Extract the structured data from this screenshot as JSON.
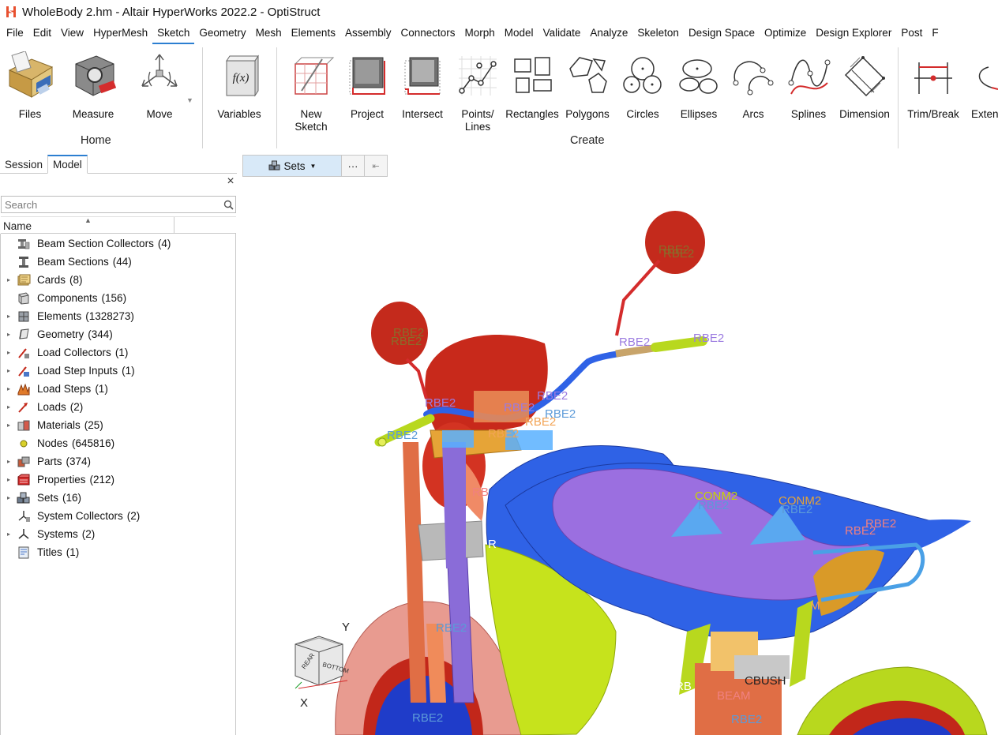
{
  "window": {
    "title": "WholeBody 2.hm - Altair HyperWorks 2022.2 - OptiStruct"
  },
  "menu": [
    "File",
    "Edit",
    "View",
    "HyperMesh",
    "Sketch",
    "Geometry",
    "Mesh",
    "Elements",
    "Assembly",
    "Connectors",
    "Morph",
    "Model",
    "Validate",
    "Analyze",
    "Skeleton",
    "Design Space",
    "Optimize",
    "Design Explorer",
    "Post",
    "F"
  ],
  "menu_active": "Sketch",
  "ribbon": {
    "home_group": "Home",
    "create_group": "Create",
    "files": "Files",
    "measure": "Measure",
    "move": "Move",
    "variables": "Variables",
    "new_sketch_1": "New",
    "new_sketch_2": "Sketch",
    "project": "Project",
    "intersect": "Intersect",
    "points_1": "Points/",
    "points_2": "Lines",
    "rectangles": "Rectangles",
    "polygons": "Polygons",
    "circles": "Circles",
    "ellipses": "Ellipses",
    "arcs": "Arcs",
    "splines": "Splines",
    "dimension": "Dimension",
    "trim_break": "Trim/Break",
    "extend": "Exten"
  },
  "panel": {
    "tab_session": "Session",
    "tab_model": "Model",
    "close": "×",
    "search_placeholder": "Search",
    "col_name": "Name"
  },
  "tree": [
    {
      "label": "Beam Section Collectors",
      "count": "(4)",
      "expandable": false,
      "icon": "beam-section-collector-icon"
    },
    {
      "label": "Beam Sections",
      "count": "(44)",
      "expandable": false,
      "icon": "beam-section-icon"
    },
    {
      "label": "Cards",
      "count": "(8)",
      "expandable": true,
      "icon": "cards-icon"
    },
    {
      "label": "Components",
      "count": "(156)",
      "expandable": false,
      "icon": "component-icon"
    },
    {
      "label": "Elements",
      "count": "(1328273)",
      "expandable": true,
      "icon": "elements-icon"
    },
    {
      "label": "Geometry",
      "count": "(344)",
      "expandable": true,
      "icon": "geometry-icon"
    },
    {
      "label": "Load Collectors",
      "count": "(1)",
      "expandable": true,
      "icon": "load-collector-icon"
    },
    {
      "label": "Load Step Inputs",
      "count": "(1)",
      "expandable": true,
      "icon": "load-step-input-icon"
    },
    {
      "label": "Load Steps",
      "count": "(1)",
      "expandable": true,
      "icon": "load-steps-icon"
    },
    {
      "label": "Loads",
      "count": "(2)",
      "expandable": true,
      "icon": "loads-icon"
    },
    {
      "label": "Materials",
      "count": "(25)",
      "expandable": true,
      "icon": "materials-icon"
    },
    {
      "label": "Nodes",
      "count": "(645816)",
      "expandable": false,
      "icon": "nodes-icon"
    },
    {
      "label": "Parts",
      "count": "(374)",
      "expandable": true,
      "icon": "parts-icon"
    },
    {
      "label": "Properties",
      "count": "(212)",
      "expandable": true,
      "icon": "properties-icon"
    },
    {
      "label": "Sets",
      "count": "(16)",
      "expandable": true,
      "icon": "sets-icon"
    },
    {
      "label": "System Collectors",
      "count": "(2)",
      "expandable": false,
      "icon": "system-collector-icon"
    },
    {
      "label": "Systems",
      "count": "(2)",
      "expandable": true,
      "icon": "systems-icon"
    },
    {
      "label": "Titles",
      "count": "(1)",
      "expandable": false,
      "icon": "titles-icon"
    }
  ],
  "viewport": {
    "sets_label": "Sets",
    "more": "···",
    "collapse": "⇤",
    "axis_y": "Y",
    "axis_x": "X",
    "cube_rear": "REAR",
    "cube_bottom": "BOTTOM",
    "labels": {
      "rbe2": "RBE2",
      "conm2": "CONM2",
      "cbush": "CBUSH",
      "beam": "BEAM",
      "partial_rb": "RB",
      "partial_r": "R",
      "partial_m": "M"
    }
  },
  "colors": {
    "accent": "#2c7fd1",
    "rbe2_label": "#8a6c2a",
    "rbe2_blue": "#5c9ad8",
    "rbe2_purple": "#9b7be0",
    "conm2": "#c8d400"
  }
}
